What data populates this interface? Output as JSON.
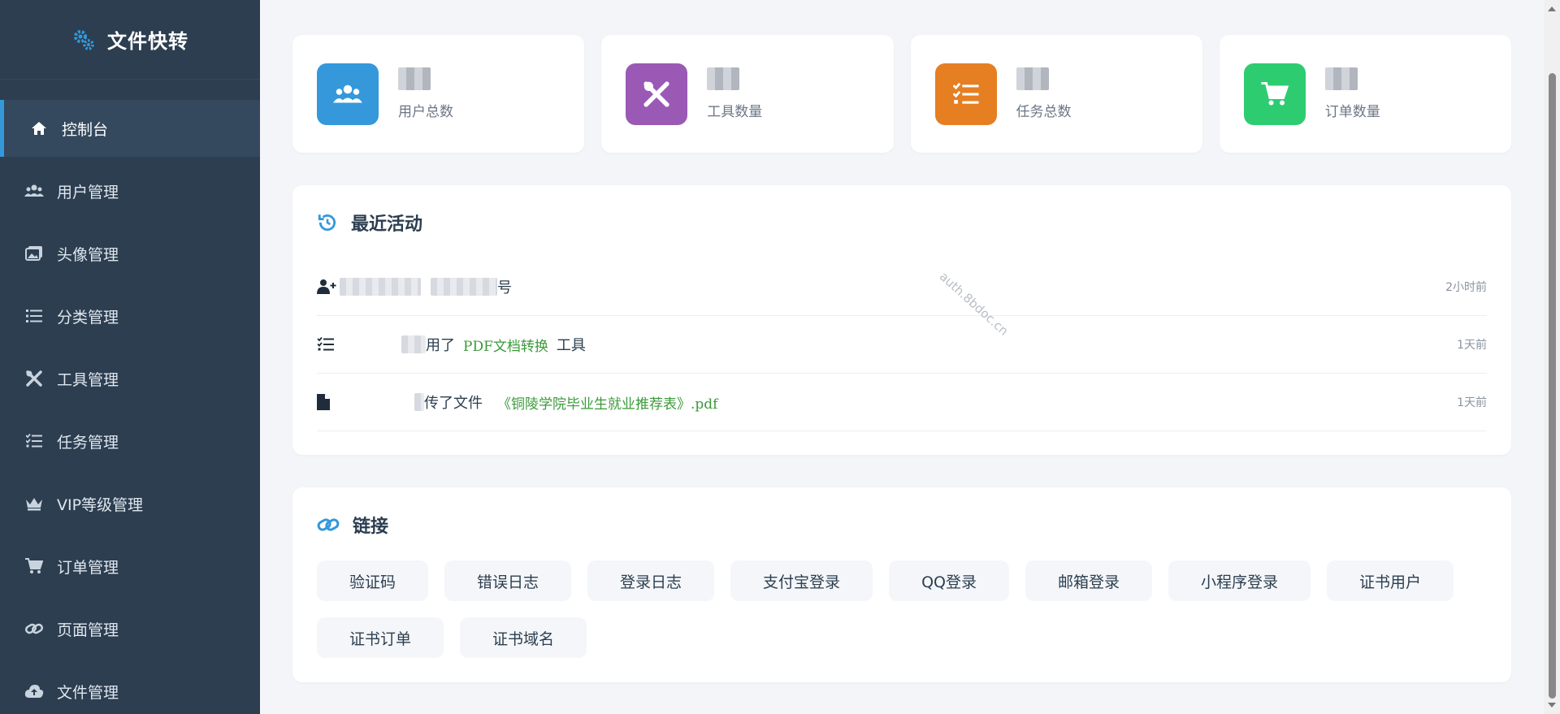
{
  "app": {
    "title": "文件快转"
  },
  "sidebar": {
    "items": [
      {
        "label": "控制台",
        "icon": "home-icon",
        "active": true
      },
      {
        "label": "用户管理",
        "icon": "users-icon"
      },
      {
        "label": "头像管理",
        "icon": "image-icon"
      },
      {
        "label": "分类管理",
        "icon": "list-icon"
      },
      {
        "label": "工具管理",
        "icon": "tools-icon"
      },
      {
        "label": "任务管理",
        "icon": "tasks-icon"
      },
      {
        "label": "VIP等级管理",
        "icon": "crown-icon"
      },
      {
        "label": "订单管理",
        "icon": "cart-icon"
      },
      {
        "label": "页面管理",
        "icon": "link-icon"
      },
      {
        "label": "文件管理",
        "icon": "cloud-upload-icon"
      }
    ]
  },
  "stats": [
    {
      "label": "用户总数",
      "icon": "users-icon",
      "color": "#3498db"
    },
    {
      "label": "工具数量",
      "icon": "tools-icon",
      "color": "#9b59b6"
    },
    {
      "label": "任务总数",
      "icon": "tasks-icon",
      "color": "#e67e22"
    },
    {
      "label": "订单数量",
      "icon": "cart-icon",
      "color": "#2ecc71"
    }
  ],
  "activity": {
    "title": "最近活动",
    "items": [
      {
        "icon": "user-plus-icon",
        "suffix": "号",
        "time": "2小时前"
      },
      {
        "icon": "tasks-icon",
        "text1": "用了",
        "highlight": "PDF文档转换",
        "text2": "工具",
        "time": "1天前"
      },
      {
        "icon": "file-icon",
        "text1": "传了文件",
        "highlight": "《铜陵学院毕业生就业推荐表》.pdf",
        "time": "1天前"
      }
    ]
  },
  "links": {
    "title": "链接",
    "items": [
      "验证码",
      "错误日志",
      "登录日志",
      "支付宝登录",
      "QQ登录",
      "邮箱登录",
      "小程序登录",
      "证书用户",
      "证书订单",
      "证书域名"
    ]
  },
  "watermark": "auth.8bdoc.cn",
  "colors": {
    "sidebar": "#2c3e50",
    "accent": "#3498db",
    "highlight": "#3a9a3a"
  }
}
